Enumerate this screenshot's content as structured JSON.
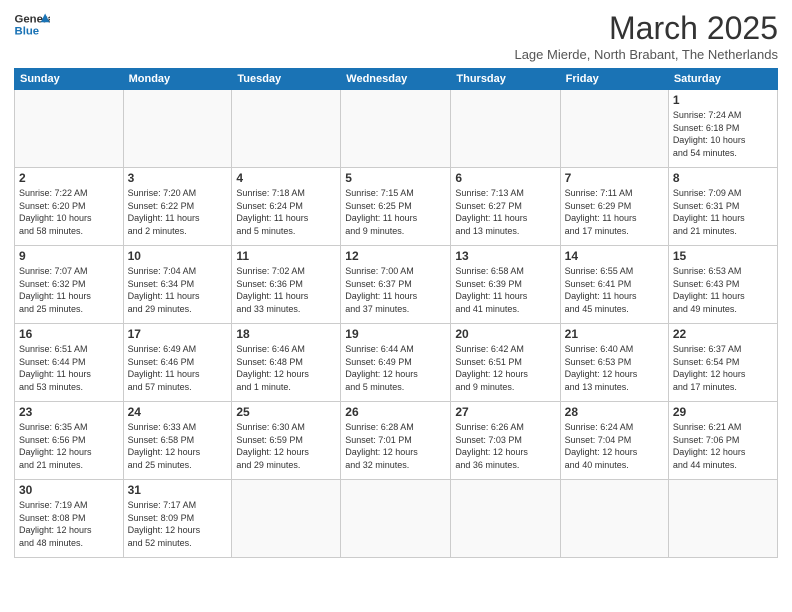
{
  "header": {
    "logo_general": "General",
    "logo_blue": "Blue",
    "month_title": "March 2025",
    "subtitle": "Lage Mierde, North Brabant, The Netherlands"
  },
  "columns": [
    "Sunday",
    "Monday",
    "Tuesday",
    "Wednesday",
    "Thursday",
    "Friday",
    "Saturday"
  ],
  "weeks": [
    [
      {
        "day": "",
        "info": ""
      },
      {
        "day": "",
        "info": ""
      },
      {
        "day": "",
        "info": ""
      },
      {
        "day": "",
        "info": ""
      },
      {
        "day": "",
        "info": ""
      },
      {
        "day": "",
        "info": ""
      },
      {
        "day": "1",
        "info": "Sunrise: 7:24 AM\nSunset: 6:18 PM\nDaylight: 10 hours\nand 54 minutes."
      }
    ],
    [
      {
        "day": "2",
        "info": "Sunrise: 7:22 AM\nSunset: 6:20 PM\nDaylight: 10 hours\nand 58 minutes."
      },
      {
        "day": "3",
        "info": "Sunrise: 7:20 AM\nSunset: 6:22 PM\nDaylight: 11 hours\nand 2 minutes."
      },
      {
        "day": "4",
        "info": "Sunrise: 7:18 AM\nSunset: 6:24 PM\nDaylight: 11 hours\nand 5 minutes."
      },
      {
        "day": "5",
        "info": "Sunrise: 7:15 AM\nSunset: 6:25 PM\nDaylight: 11 hours\nand 9 minutes."
      },
      {
        "day": "6",
        "info": "Sunrise: 7:13 AM\nSunset: 6:27 PM\nDaylight: 11 hours\nand 13 minutes."
      },
      {
        "day": "7",
        "info": "Sunrise: 7:11 AM\nSunset: 6:29 PM\nDaylight: 11 hours\nand 17 minutes."
      },
      {
        "day": "8",
        "info": "Sunrise: 7:09 AM\nSunset: 6:31 PM\nDaylight: 11 hours\nand 21 minutes."
      }
    ],
    [
      {
        "day": "9",
        "info": "Sunrise: 7:07 AM\nSunset: 6:32 PM\nDaylight: 11 hours\nand 25 minutes."
      },
      {
        "day": "10",
        "info": "Sunrise: 7:04 AM\nSunset: 6:34 PM\nDaylight: 11 hours\nand 29 minutes."
      },
      {
        "day": "11",
        "info": "Sunrise: 7:02 AM\nSunset: 6:36 PM\nDaylight: 11 hours\nand 33 minutes."
      },
      {
        "day": "12",
        "info": "Sunrise: 7:00 AM\nSunset: 6:37 PM\nDaylight: 11 hours\nand 37 minutes."
      },
      {
        "day": "13",
        "info": "Sunrise: 6:58 AM\nSunset: 6:39 PM\nDaylight: 11 hours\nand 41 minutes."
      },
      {
        "day": "14",
        "info": "Sunrise: 6:55 AM\nSunset: 6:41 PM\nDaylight: 11 hours\nand 45 minutes."
      },
      {
        "day": "15",
        "info": "Sunrise: 6:53 AM\nSunset: 6:43 PM\nDaylight: 11 hours\nand 49 minutes."
      }
    ],
    [
      {
        "day": "16",
        "info": "Sunrise: 6:51 AM\nSunset: 6:44 PM\nDaylight: 11 hours\nand 53 minutes."
      },
      {
        "day": "17",
        "info": "Sunrise: 6:49 AM\nSunset: 6:46 PM\nDaylight: 11 hours\nand 57 minutes."
      },
      {
        "day": "18",
        "info": "Sunrise: 6:46 AM\nSunset: 6:48 PM\nDaylight: 12 hours\nand 1 minute."
      },
      {
        "day": "19",
        "info": "Sunrise: 6:44 AM\nSunset: 6:49 PM\nDaylight: 12 hours\nand 5 minutes."
      },
      {
        "day": "20",
        "info": "Sunrise: 6:42 AM\nSunset: 6:51 PM\nDaylight: 12 hours\nand 9 minutes."
      },
      {
        "day": "21",
        "info": "Sunrise: 6:40 AM\nSunset: 6:53 PM\nDaylight: 12 hours\nand 13 minutes."
      },
      {
        "day": "22",
        "info": "Sunrise: 6:37 AM\nSunset: 6:54 PM\nDaylight: 12 hours\nand 17 minutes."
      }
    ],
    [
      {
        "day": "23",
        "info": "Sunrise: 6:35 AM\nSunset: 6:56 PM\nDaylight: 12 hours\nand 21 minutes."
      },
      {
        "day": "24",
        "info": "Sunrise: 6:33 AM\nSunset: 6:58 PM\nDaylight: 12 hours\nand 25 minutes."
      },
      {
        "day": "25",
        "info": "Sunrise: 6:30 AM\nSunset: 6:59 PM\nDaylight: 12 hours\nand 29 minutes."
      },
      {
        "day": "26",
        "info": "Sunrise: 6:28 AM\nSunset: 7:01 PM\nDaylight: 12 hours\nand 32 minutes."
      },
      {
        "day": "27",
        "info": "Sunrise: 6:26 AM\nSunset: 7:03 PM\nDaylight: 12 hours\nand 36 minutes."
      },
      {
        "day": "28",
        "info": "Sunrise: 6:24 AM\nSunset: 7:04 PM\nDaylight: 12 hours\nand 40 minutes."
      },
      {
        "day": "29",
        "info": "Sunrise: 6:21 AM\nSunset: 7:06 PM\nDaylight: 12 hours\nand 44 minutes."
      }
    ],
    [
      {
        "day": "30",
        "info": "Sunrise: 7:19 AM\nSunset: 8:08 PM\nDaylight: 12 hours\nand 48 minutes."
      },
      {
        "day": "31",
        "info": "Sunrise: 7:17 AM\nSunset: 8:09 PM\nDaylight: 12 hours\nand 52 minutes."
      },
      {
        "day": "",
        "info": ""
      },
      {
        "day": "",
        "info": ""
      },
      {
        "day": "",
        "info": ""
      },
      {
        "day": "",
        "info": ""
      },
      {
        "day": "",
        "info": ""
      }
    ]
  ]
}
